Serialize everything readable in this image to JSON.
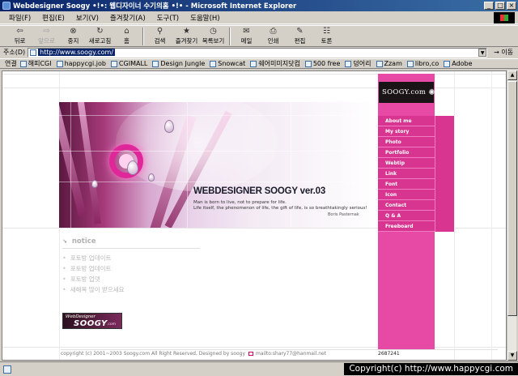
{
  "window": {
    "title": "Webdesigner Soogy •!•: 웹디자이너 수기의홈 •!• - Microsoft Internet Explorer",
    "buttons": [
      "_",
      "□",
      "×"
    ]
  },
  "menubar": [
    "파일(F)",
    "편집(E)",
    "보기(V)",
    "즐겨찾기(A)",
    "도구(T)",
    "도움말(H)"
  ],
  "toolbar": [
    {
      "label": "뒤로",
      "icon": "⇦",
      "enabled": true
    },
    {
      "label": "앞으로",
      "icon": "⇨",
      "enabled": false
    },
    {
      "label": "중지",
      "icon": "⊗",
      "enabled": true
    },
    {
      "label": "새로고침",
      "icon": "↻",
      "enabled": true
    },
    {
      "label": "홈",
      "icon": "⌂",
      "enabled": true
    },
    {
      "label": "검색",
      "icon": "⚲",
      "enabled": true
    },
    {
      "label": "즐겨찾기",
      "icon": "★",
      "enabled": true
    },
    {
      "label": "목록보기",
      "icon": "◷",
      "enabled": true
    },
    {
      "label": "메일",
      "icon": "✉",
      "enabled": true
    },
    {
      "label": "인쇄",
      "icon": "⎙",
      "enabled": true
    },
    {
      "label": "편집",
      "icon": "✎",
      "enabled": true
    },
    {
      "label": "토론",
      "icon": "☷",
      "enabled": true
    }
  ],
  "address": {
    "label": "주소(D)",
    "url": "http://www.soogy.com/",
    "go": "이동"
  },
  "links": {
    "title": "연결",
    "items": [
      "해피CGI",
      "happycgi.job",
      "CGIMALL",
      "Design Jungle",
      "Snowcat",
      "쉐어미미지닷컴",
      "500 free",
      "덩어리",
      "Zzam",
      "libro,co",
      "Adobe"
    ]
  },
  "page": {
    "hero": {
      "title": "WEBDESIGNER  SOOGY ver.03",
      "subtitle_lines": [
        "Man is born to live, not to prepare for life.",
        "Life itself, the phenomenon of life, the gift of life, is so breathtakingly serious!"
      ],
      "author": "Boris Pasternak"
    },
    "side": {
      "logo": "SOOGY.com",
      "menu": [
        "About me",
        "My story",
        "Photo",
        "Portfolio",
        "Webtip",
        "Link",
        "Font",
        "Icon",
        "Contact",
        "Q & A",
        "Freeboard"
      ]
    },
    "notice": {
      "heading": "notice",
      "items": [
        "포토방 업데이트",
        "포토방 업데이트",
        "포토방 업뎃",
        "새해복 많이 받으세요"
      ]
    },
    "banner": {
      "line1": "WebDesigner",
      "line2": "SOOGY",
      "line3": ".com"
    },
    "footer": {
      "copyright": "copyright (c) 2001~2003 Soogy.com All Right Reserved, Designed by soogy",
      "mail": "mailto:shary77@hanmail.net",
      "counter": "2687241"
    }
  },
  "status": {
    "copyright_overlay": "Copyright(c) http://www.happycgi.com"
  },
  "colors": {
    "accent_pink": "#e64aa4",
    "menu_pink": "#d7358f",
    "title_blue": "#0a246a"
  }
}
